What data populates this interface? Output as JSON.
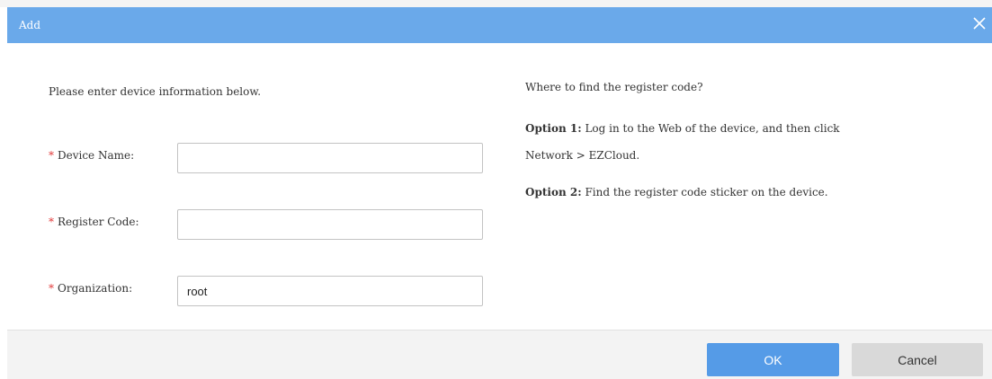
{
  "dialog": {
    "title": "Add",
    "intro": "Please enter device information below.",
    "fields": [
      {
        "required_mark": "*",
        "label": "Device Name:",
        "value": ""
      },
      {
        "required_mark": "*",
        "label": "Register Code:",
        "value": ""
      },
      {
        "required_mark": "*",
        "label": "Organization:",
        "value": "root"
      }
    ],
    "help": {
      "heading": "Where to find the register code?",
      "option1_title": "Option 1:",
      "option1_text": " Log in to the Web of the device, and then click",
      "option1_text2": "Network > EZCloud.",
      "option2_title": "Option 2:",
      "option2_text": " Find the register code sticker on the device."
    },
    "buttons": {
      "ok": "OK",
      "cancel": "Cancel"
    }
  },
  "colors": {
    "titlebar": "#6aa9ea",
    "ok_button": "#559be7",
    "cancel_button": "#d9d9d9",
    "required_mark": "#e23b3b"
  },
  "icons": {
    "close": "close-icon"
  }
}
